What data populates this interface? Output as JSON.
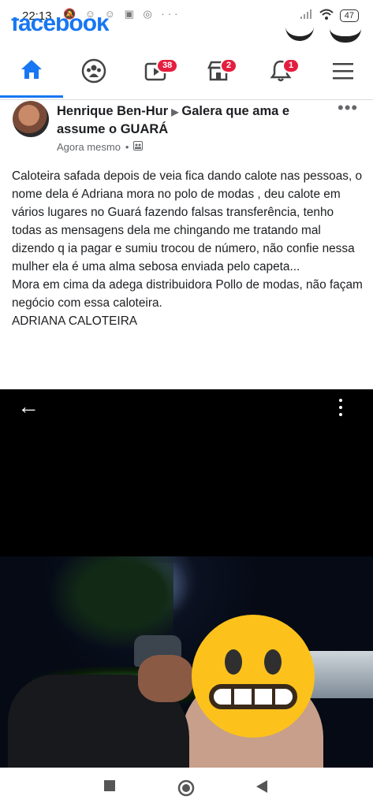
{
  "status_bar": {
    "time": "22:13",
    "battery": "47"
  },
  "app": {
    "logo_text": "facebook"
  },
  "nav": {
    "items": [
      {
        "name": "home",
        "badge": ""
      },
      {
        "name": "groups",
        "badge": ""
      },
      {
        "name": "watch",
        "badge": "38"
      },
      {
        "name": "marketplace",
        "badge": "2"
      },
      {
        "name": "notifications",
        "badge": "1"
      },
      {
        "name": "menu",
        "badge": ""
      }
    ],
    "accent": "#1877f2",
    "badge_color": "#e41e3f"
  },
  "post": {
    "author": "Henrique Ben-Hur",
    "group": "Galera que ama e assume o GUARÁ",
    "time": "Agora mesmo",
    "text": "Caloteira safada depois de veia fica dando calote nas pessoas, o nome dela é Adriana mora no polo de modas , deu calote em vários lugares no Guará fazendo falsas transferência, tenho todas as mensagens dela me chingando me tratando mal dizendo q ia pagar e sumiu trocou de número, não confie nessa mulher ela é uma alma sebosa enviada pelo capeta...\nMora em cima da adega distribuidora Pollo de modas, não façam negócio com essa caloteira.\nADRIANA CALOTEIRA"
  }
}
